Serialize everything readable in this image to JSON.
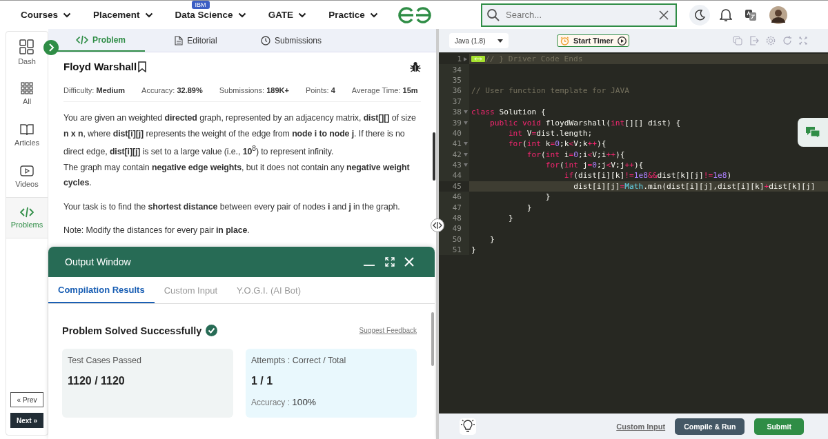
{
  "nav": {
    "items": [
      {
        "label": "Courses"
      },
      {
        "label": "Placement"
      },
      {
        "label": "Data Science",
        "badge": "IBM"
      },
      {
        "label": "GATE"
      },
      {
        "label": "Practice"
      }
    ],
    "search": {
      "placeholder": "Search..."
    }
  },
  "sidebar": {
    "items": [
      {
        "label": "Dash",
        "selected": false
      },
      {
        "label": "All",
        "selected": false
      },
      {
        "label": "Articles",
        "selected": false
      },
      {
        "label": "Videos",
        "selected": false
      },
      {
        "label": "Problems",
        "selected": true
      }
    ],
    "prev": "« Prev",
    "next": "Next »"
  },
  "problem_tabs": [
    {
      "label": "Problem",
      "selected": true
    },
    {
      "label": "Editorial",
      "selected": false
    },
    {
      "label": "Submissions",
      "selected": false
    }
  ],
  "problem": {
    "title": "Floyd Warshall",
    "stats": [
      {
        "label": "Difficulty:",
        "value": "Medium"
      },
      {
        "label": "Accuracy:",
        "value": "32.89%"
      },
      {
        "label": "Submissions:",
        "value": "189K+"
      },
      {
        "label": "Points:",
        "value": "4"
      },
      {
        "label": "Average Time:",
        "value": "15m"
      }
    ],
    "description": [
      [
        "You are given an weighted **directed** graph, represented by an adjacency matrix, **dist[][]** of size **n x n**, where **dist[i][j]** represents the weight of the edge from **node i to node j**. If there is no direct edge, **dist[i][j]** is set to a large value (i.e., **10**$^{8}$) to represent infinity.",
        "The graph may contain **negative edge weights**, but it does not contain any **negative weight cycles**."
      ],
      [
        "Your task is to find the **shortest distance** between every pair of nodes **i** and **j** in the graph."
      ],
      [
        "Note: Modify the distances for every pair **in place**."
      ]
    ]
  },
  "output_window": {
    "title": "Output Window",
    "tabs": [
      {
        "label": "Compilation Results",
        "selected": true
      },
      {
        "label": "Custom Input",
        "selected": false
      },
      {
        "label": "Y.O.G.I. (AI Bot)",
        "selected": false
      }
    ],
    "status": "Problem Solved Successfully",
    "feedback": "Suggest Feedback",
    "cards": [
      {
        "label": "Test Cases Passed",
        "value": "1120 / 1120"
      },
      {
        "label": "Attempts : Correct / Total",
        "value": "1 / 1",
        "extra_label": "Accuracy :",
        "extra_value": "100%"
      }
    ]
  },
  "editor": {
    "language": "Java (1.8)",
    "timer": "Start Timer",
    "lines": [
      {
        "number": "1",
        "active": true,
        "fold_open": false,
        "tokens": [
          {
            "kind": "comment",
            "text": "// } Driver Code Ends"
          }
        ]
      },
      {
        "number": "34",
        "active": false
      },
      {
        "number": "35",
        "active": false
      },
      {
        "number": "36",
        "active": false,
        "tokens": [
          {
            "kind": "comment",
            "text": "// User function template for JAVA"
          }
        ]
      },
      {
        "number": "37",
        "active": false
      },
      {
        "number": "38",
        "active": false,
        "fold_open": true,
        "tokens": [
          {
            "kind": "keyword",
            "text": "class"
          },
          {
            "kind": "plain",
            "text": " Solution {"
          }
        ]
      },
      {
        "number": "39",
        "active": false,
        "fold_open": true,
        "tokens": [
          {
            "kind": "keyword",
            "text": "    public void"
          },
          {
            "kind": "plain",
            "text": " floydWarshall("
          },
          {
            "kind": "keyword",
            "text": "int"
          },
          {
            "kind": "plain",
            "text": "[][] dist) {"
          }
        ]
      },
      {
        "number": "40",
        "active": false,
        "tokens": [
          {
            "kind": "keyword",
            "text": "        int"
          },
          {
            "kind": "plain",
            "text": " V"
          },
          {
            "kind": "keyword",
            "text": "="
          },
          {
            "kind": "plain",
            "text": "dist.length;"
          }
        ]
      },
      {
        "number": "41",
        "active": false,
        "fold_open": true,
        "tokens": [
          {
            "kind": "keyword",
            "text": "        for"
          },
          {
            "kind": "plain",
            "text": "("
          },
          {
            "kind": "keyword",
            "text": "int"
          },
          {
            "kind": "plain",
            "text": " k"
          },
          {
            "kind": "keyword",
            "text": "="
          },
          {
            "kind": "number",
            "text": "0"
          },
          {
            "kind": "plain",
            "text": ";k"
          },
          {
            "kind": "keyword",
            "text": "<"
          },
          {
            "kind": "plain",
            "text": "V;k"
          },
          {
            "kind": "keyword",
            "text": "++"
          },
          {
            "kind": "plain",
            "text": "){"
          }
        ]
      },
      {
        "number": "42",
        "active": false,
        "fold_open": true,
        "tokens": [
          {
            "kind": "keyword",
            "text": "            for"
          },
          {
            "kind": "plain",
            "text": "("
          },
          {
            "kind": "keyword",
            "text": "int"
          },
          {
            "kind": "plain",
            "text": " i"
          },
          {
            "kind": "keyword",
            "text": "="
          },
          {
            "kind": "number",
            "text": "0"
          },
          {
            "kind": "plain",
            "text": ";i"
          },
          {
            "kind": "keyword",
            "text": "<"
          },
          {
            "kind": "plain",
            "text": "V;i"
          },
          {
            "kind": "keyword",
            "text": "++"
          },
          {
            "kind": "plain",
            "text": "){"
          }
        ]
      },
      {
        "number": "43",
        "active": false,
        "fold_open": true,
        "tokens": [
          {
            "kind": "keyword",
            "text": "                for"
          },
          {
            "kind": "plain",
            "text": "("
          },
          {
            "kind": "keyword",
            "text": "int"
          },
          {
            "kind": "plain",
            "text": " j"
          },
          {
            "kind": "keyword",
            "text": "="
          },
          {
            "kind": "number",
            "text": "0"
          },
          {
            "kind": "plain",
            "text": ";j"
          },
          {
            "kind": "keyword",
            "text": "<"
          },
          {
            "kind": "plain",
            "text": "V;j"
          },
          {
            "kind": "keyword",
            "text": "++"
          },
          {
            "kind": "plain",
            "text": "){"
          }
        ]
      },
      {
        "number": "44",
        "active": false,
        "tokens": [
          {
            "kind": "keyword",
            "text": "                    if"
          },
          {
            "kind": "plain",
            "text": "(dist[i][k]"
          },
          {
            "kind": "keyword",
            "text": "!="
          },
          {
            "kind": "number",
            "text": "1e8"
          },
          {
            "kind": "keyword",
            "text": "&&"
          },
          {
            "kind": "plain",
            "text": "dist[k][j]"
          },
          {
            "kind": "keyword",
            "text": "!="
          },
          {
            "kind": "number",
            "text": "1e8"
          },
          {
            "kind": "plain",
            "text": ")"
          }
        ]
      },
      {
        "number": "45",
        "active": true,
        "tokens": [
          {
            "kind": "plain",
            "text": "                      dist[i][j]"
          },
          {
            "kind": "keyword",
            "text": "="
          },
          {
            "kind": "type",
            "text": "Math"
          },
          {
            "kind": "plain",
            "text": ".min(dist[i][j],dist[i][k]"
          },
          {
            "kind": "keyword",
            "text": "+"
          },
          {
            "kind": "plain",
            "text": "dist[k][j]"
          }
        ]
      },
      {
        "number": "46",
        "active": false,
        "tokens": [
          {
            "kind": "plain",
            "text": "                }"
          }
        ]
      },
      {
        "number": "47",
        "active": false,
        "tokens": [
          {
            "kind": "plain",
            "text": "            }"
          }
        ]
      },
      {
        "number": "48",
        "active": false,
        "tokens": [
          {
            "kind": "plain",
            "text": "        }"
          }
        ]
      },
      {
        "number": "49",
        "active": false
      },
      {
        "number": "50",
        "active": false,
        "tokens": [
          {
            "kind": "plain",
            "text": "    }"
          }
        ]
      },
      {
        "number": "51",
        "active": false,
        "tokens": [
          {
            "kind": "plain",
            "text": "}"
          }
        ]
      }
    ],
    "custom_input": "Custom Input",
    "compile": "Compile & Run",
    "submit": "Submit"
  }
}
